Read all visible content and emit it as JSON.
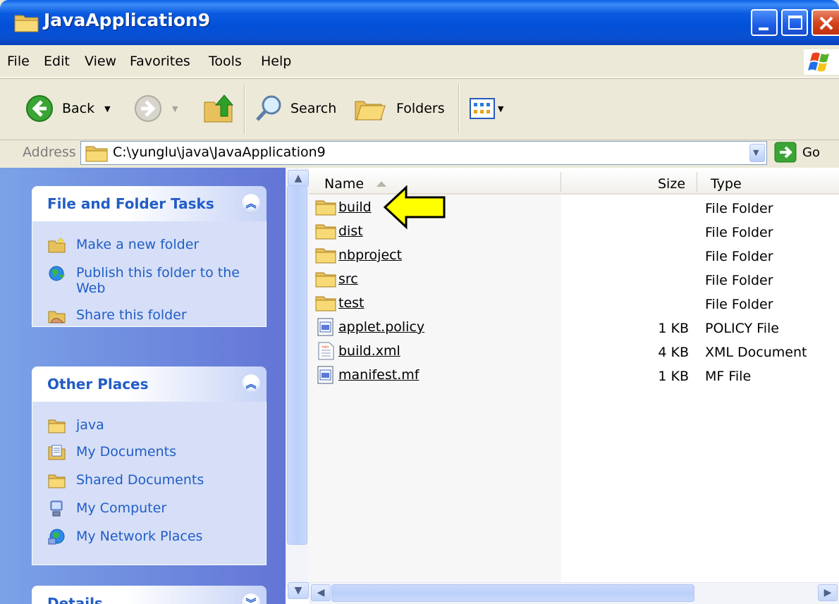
{
  "window": {
    "title": "JavaApplication9"
  },
  "menu": {
    "items": [
      "File",
      "Edit",
      "View",
      "Favorites",
      "Tools",
      "Help"
    ]
  },
  "toolbar": {
    "back_label": "Back",
    "search_label": "Search",
    "folders_label": "Folders"
  },
  "address": {
    "label": "Address",
    "path": "C:\\yunglu\\java\\JavaApplication9",
    "go_label": "Go"
  },
  "tasks_panel": {
    "title": "File and Folder Tasks",
    "items": [
      {
        "label": "Make a new folder",
        "icon": "new-folder-icon"
      },
      {
        "label": "Publish this folder to the Web",
        "icon": "publish-web-icon"
      },
      {
        "label": "Share this folder",
        "icon": "share-folder-icon"
      }
    ]
  },
  "places_panel": {
    "title": "Other Places",
    "items": [
      {
        "label": "java",
        "icon": "folder-icon"
      },
      {
        "label": "My Documents",
        "icon": "my-documents-icon"
      },
      {
        "label": "Shared Documents",
        "icon": "folder-icon"
      },
      {
        "label": "My Computer",
        "icon": "my-computer-icon"
      },
      {
        "label": "My Network Places",
        "icon": "network-places-icon"
      }
    ]
  },
  "details_panel": {
    "title": "Details"
  },
  "file_list": {
    "columns": [
      "Name",
      "Size",
      "Type"
    ],
    "rows": [
      {
        "name": "build",
        "size": "",
        "type": "File Folder",
        "icon": "folder-icon"
      },
      {
        "name": "dist",
        "size": "",
        "type": "File Folder",
        "icon": "folder-icon"
      },
      {
        "name": "nbproject",
        "size": "",
        "type": "File Folder",
        "icon": "folder-icon"
      },
      {
        "name": "src",
        "size": "",
        "type": "File Folder",
        "icon": "folder-icon"
      },
      {
        "name": "test",
        "size": "",
        "type": "File Folder",
        "icon": "folder-icon"
      },
      {
        "name": "applet.policy",
        "size": "1 KB",
        "type": "POLICY File",
        "icon": "generic-file-icon"
      },
      {
        "name": "build.xml",
        "size": "4 KB",
        "type": "XML Document",
        "icon": "xml-file-icon"
      },
      {
        "name": "manifest.mf",
        "size": "1 KB",
        "type": "MF File",
        "icon": "generic-file-icon"
      }
    ]
  },
  "colors": {
    "titlebar": "#0350d8",
    "link_blue": "#215dc6",
    "panel_bg": "#d6dff7",
    "pointer_arrow": "#ffff00"
  }
}
